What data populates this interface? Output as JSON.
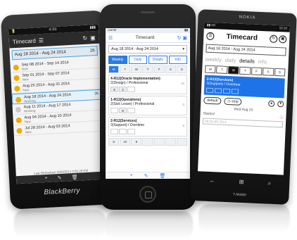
{
  "blackberry": {
    "status": {
      "left": "🔋",
      "center": "4:00",
      "right": "▮▮▮"
    },
    "title": "Timecard",
    "range": "Aug 18 2014 - Aug 24 2014",
    "range_hours": "26",
    "rows": [
      {
        "dates": "Sep 08 2014 - Sep 14 2014",
        "status": "New",
        "hours": ""
      },
      {
        "dates": "Sep 01 2014 - Sep 07 2014",
        "status": "New",
        "hours": ""
      },
      {
        "dates": "Aug 25 2014 - Aug 31 2014",
        "status": "New",
        "hours": ""
      },
      {
        "dates": "Aug 18 2014 - Aug 24 2014",
        "status": "Working",
        "hours": "26"
      },
      {
        "dates": "Aug 11 2014 - Aug 17 2014",
        "status": "Working",
        "hours": ""
      },
      {
        "dates": "Aug 04 2014 - Aug 10 2014",
        "status": "New",
        "hours": ""
      },
      {
        "dates": "Jul 28 2014 - Aug 03 2014",
        "status": "New",
        "hours": ""
      }
    ],
    "last_refreshed": "Last Refreshed: 8/20/2014 3:05:28 PM",
    "toolbar": {
      "add": "+",
      "edit": "✎",
      "delete": "🗑"
    },
    "brand": "BlackBerry"
  },
  "iphone": {
    "status": {
      "left": "carrier",
      "right": "▮▮"
    },
    "title": "Timecard",
    "range": "Aug 18 2014 - Aug 24 2014",
    "tabs": [
      "Weekly",
      "Daily",
      "Details",
      "Info"
    ],
    "days": [
      "M",
      "T",
      "W",
      "T",
      "F",
      "S",
      "S"
    ],
    "entries": [
      {
        "name": "4-R12(Oracle Implementation)",
        "sub": "2(Design) / Professional",
        "hours": "16",
        "cells": [
          "8",
          "2",
          "",
          "",
          "",
          "",
          ""
        ]
      },
      {
        "name": "1-R12(Operations)",
        "sub": "2(Sick Leave) / Professional",
        "hours": "0",
        "cells": [
          "",
          "8",
          "",
          "",
          "",
          "",
          ""
        ]
      },
      {
        "name": "2-R12(Services)",
        "sub": "3(Support) / Overtime",
        "hours": "8",
        "cells": [
          "",
          "",
          "",
          "",
          "",
          "",
          ""
        ]
      }
    ],
    "totals": [
      "8",
      "10",
      "8",
      "",
      "",
      "",
      ""
    ],
    "toolbar": {
      "add": "+",
      "edit": "✎",
      "delete": "🗑"
    }
  },
  "windows_phone": {
    "brand": "NOKIA",
    "status": {
      "left": "▮▮ 4G",
      "right": "10:10"
    },
    "title": "Timecard",
    "range": "Aug 18 2014 - Aug 24 2014",
    "pivots": [
      "weekly",
      "daily",
      "details",
      "info"
    ],
    "active_pivot": "details",
    "days": [
      "M",
      "T",
      "W",
      "T",
      "F",
      "S",
      "S"
    ],
    "project": "2-R12(Services)",
    "task": "3(Support) / Overtime",
    "default_label": "default",
    "stop_label": "stop",
    "date": "Wed Aug 20",
    "started_label": "Started",
    "started_value": "08:23 AM 2014",
    "carrier": "T-Mobile"
  }
}
